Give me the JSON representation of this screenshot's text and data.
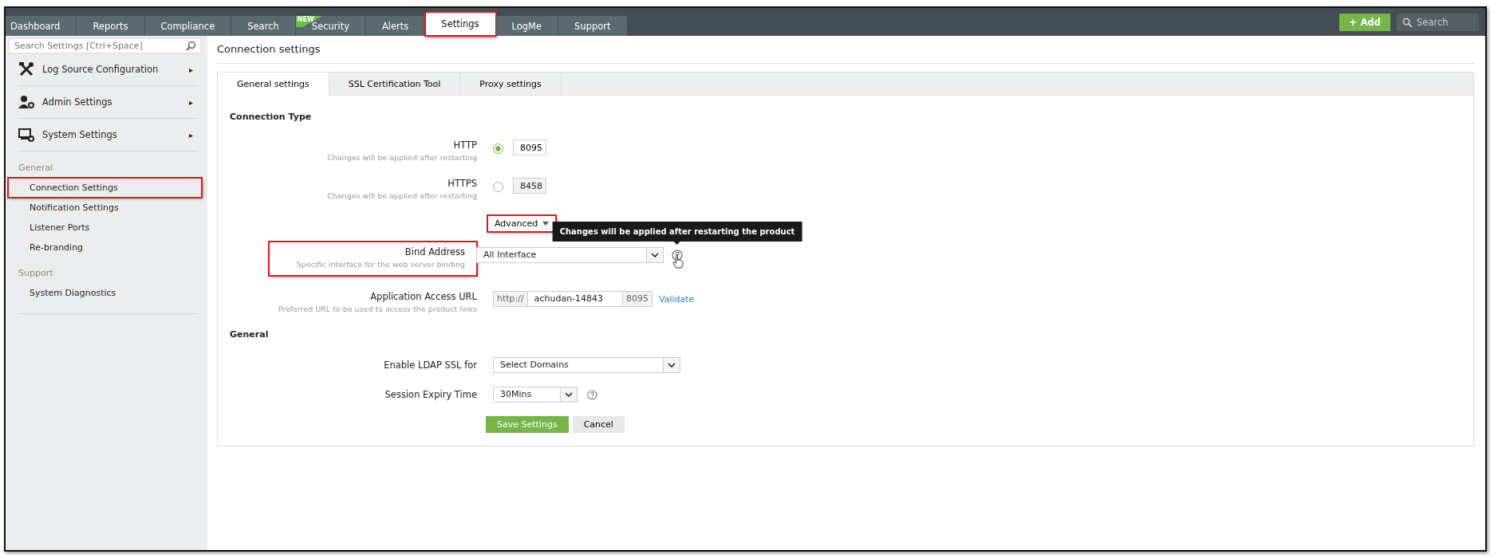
{
  "nav": {
    "tabs": [
      {
        "label": "Dashboard",
        "selected": false,
        "highlighted": false
      },
      {
        "label": "Reports",
        "selected": false,
        "highlighted": false
      },
      {
        "label": "Compliance",
        "selected": false,
        "highlighted": false
      },
      {
        "label": "Search",
        "selected": false,
        "highlighted": false
      },
      {
        "label": "Security",
        "selected": false,
        "highlighted": false,
        "badge": "NEW"
      },
      {
        "label": "Alerts",
        "selected": false,
        "highlighted": false
      },
      {
        "label": "Settings",
        "selected": true,
        "highlighted": true
      },
      {
        "label": "LogMe",
        "selected": false,
        "highlighted": false
      },
      {
        "label": "Support",
        "selected": false,
        "highlighted": false
      }
    ],
    "add_button": {
      "icon": "+",
      "label": "Add"
    },
    "search": {
      "placeholder": "Search"
    }
  },
  "sidebar": {
    "search": {
      "placeholder": "Search Settings [Ctrl+Space]"
    },
    "menus": [
      {
        "label": "Log Source Configuration",
        "arrow": "▸"
      },
      {
        "label": "Admin Settings",
        "arrow": "▸"
      },
      {
        "label": "System Settings",
        "arrow": "▸"
      }
    ],
    "sections": [
      {
        "heading": "General",
        "items": [
          {
            "label": "Connection Settings",
            "highlighted": true
          },
          {
            "label": "Notification Settings",
            "highlighted": false
          },
          {
            "label": "Listener Ports",
            "highlighted": false
          },
          {
            "label": "Re-branding",
            "highlighted": false
          }
        ]
      },
      {
        "heading": "Support",
        "items": [
          {
            "label": "System Diagnostics",
            "highlighted": false
          }
        ]
      }
    ]
  },
  "page": {
    "title": "Connection settings",
    "tabs": [
      {
        "label": "General settings",
        "selected": true
      },
      {
        "label": "SSL Certification Tool",
        "selected": false
      },
      {
        "label": "Proxy settings",
        "selected": false
      }
    ],
    "connection_type": {
      "heading": "Connection Type",
      "options": [
        {
          "label": "HTTP",
          "hint": "Changes will be applied after restarting",
          "checked": true,
          "port": "8095",
          "disabled": false
        },
        {
          "label": "HTTPS",
          "hint": "Changes will be applied after restarting",
          "checked": false,
          "port": "8458",
          "disabled": true
        }
      ]
    },
    "advanced": {
      "label": "Advanced",
      "highlighted": true
    },
    "bind_address": {
      "label": "Bind Address",
      "hint": "Specific interface for the web server binding",
      "value": "All Interface",
      "highlighted": true,
      "tooltip": "Changes will be applied after restarting the product"
    },
    "access_url": {
      "label": "Application Access URL",
      "hint": "Preferred URL to be used to access the product links",
      "prefix": "http://",
      "value": "achudan-14843",
      "suffix": "8095",
      "link": "Validate"
    },
    "general": {
      "heading": "General",
      "ldap": {
        "label": "Enable LDAP SSL for",
        "value": "Select Domains"
      },
      "session": {
        "label": "Session Expiry Time",
        "value": "30Mins"
      }
    },
    "buttons": {
      "save": "Save Settings",
      "cancel": "Cancel"
    }
  }
}
